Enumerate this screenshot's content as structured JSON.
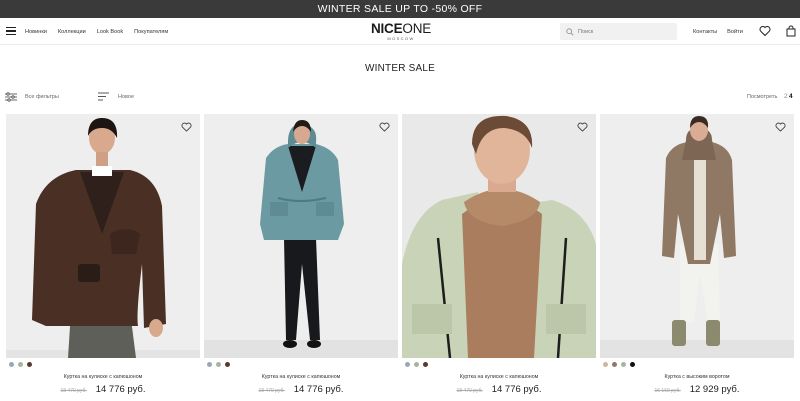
{
  "promo": {
    "text": "WINTER SALE UP TO -50% OFF"
  },
  "header": {
    "nav": [
      "Новинки",
      "Коллекции",
      "Look Book",
      "Покупателям"
    ],
    "logo": {
      "main_bold": "NICE",
      "main_light": "ONE",
      "sub": "MOSCOW"
    },
    "search": {
      "placeholder": "Поиск"
    },
    "links": [
      "Контакты",
      "Войти"
    ]
  },
  "page": {
    "title": "WINTER SALE"
  },
  "toolbar": {
    "filters_label": "Все фильтры",
    "sort_label": "Новое",
    "view_label": "Посмотреть",
    "view_options": [
      "2",
      "4"
    ]
  },
  "products": [
    {
      "name": "Куртка на кулиске с капюшоном",
      "old_price": "18 470 руб.",
      "price": "14 776 руб.",
      "swatches": [
        "#9aa8b3",
        "#a8b59c",
        "#5a3a2c"
      ]
    },
    {
      "name": "Куртка на кулиске с капюшоном",
      "old_price": "18 470 руб.",
      "price": "14 776 руб.",
      "swatches": [
        "#9aa8b3",
        "#a8b59c",
        "#5a3a2c"
      ]
    },
    {
      "name": "Куртка на кулиске с капюшоном",
      "old_price": "18 470 руб.",
      "price": "14 776 руб.",
      "swatches": [
        "#9aa8b3",
        "#a8b59c",
        "#5a3a2c"
      ]
    },
    {
      "name": "Куртка с высоким воротом",
      "old_price": "16 160 руб.",
      "price": "12 929 руб.",
      "swatches": [
        "#c9b7a0",
        "#8c7a68",
        "#a8b59c",
        "#111111"
      ]
    }
  ]
}
